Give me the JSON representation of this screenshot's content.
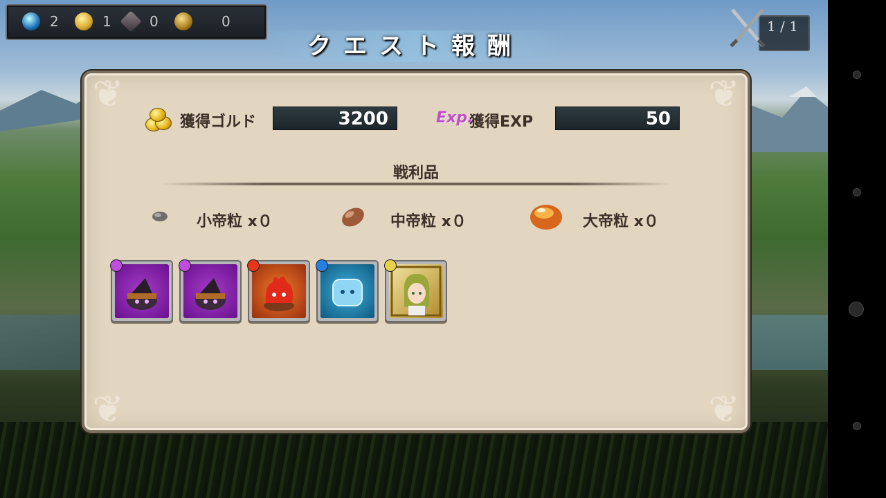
{
  "currency": [
    {
      "icon": "blue-orb-icon",
      "value": "2"
    },
    {
      "icon": "gold-orb-icon",
      "value": "1"
    },
    {
      "icon": "dark-crystal-icon",
      "value": "0"
    },
    {
      "icon": "gold-coin-pouch-icon",
      "value": "0"
    }
  ],
  "title": "クエスト報酬",
  "battle": {
    "icon": "crossed-swords-icon",
    "current": "1",
    "total": "1"
  },
  "gold": {
    "label": "獲得ゴルド",
    "value": "3200",
    "icon": "gold-coins-icon"
  },
  "exp": {
    "badge": "Exp.",
    "label": "獲得EXP",
    "value": "50"
  },
  "spoils_title": "戦利品",
  "grains": [
    {
      "icon": "small-grain-icon",
      "label": "小帝粒 x０"
    },
    {
      "icon": "medium-grain-icon",
      "label": "中帝粒 x０"
    },
    {
      "icon": "large-grain-icon",
      "label": "大帝粒 x０"
    }
  ],
  "items": [
    {
      "icon": "dark-witch-hat-slime-icon",
      "element": "dark",
      "bg": "#7b1fa2"
    },
    {
      "icon": "dark-witch-hat-slime-icon",
      "element": "dark",
      "bg": "#7b1fa2"
    },
    {
      "icon": "fire-slime-icon",
      "element": "fire",
      "bg": "#d9531e"
    },
    {
      "icon": "ice-slime-icon",
      "element": "water",
      "bg": "#1e88b8"
    },
    {
      "icon": "blonde-hero-portrait-icon",
      "element": "light",
      "bg": "#c9a640"
    }
  ],
  "colors": {
    "panel": "#e2d6c1",
    "value_box": "#263137",
    "exp_badge": "#c44cc9"
  }
}
